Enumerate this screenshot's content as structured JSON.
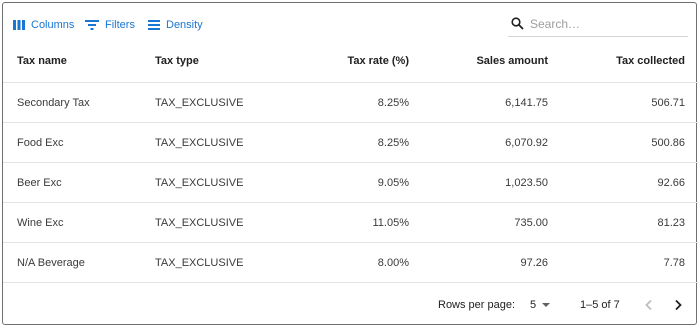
{
  "toolbar": {
    "columns_label": "Columns",
    "filters_label": "Filters",
    "density_label": "Density",
    "search_placeholder": "Search…",
    "accent_color": "#1976d2"
  },
  "table": {
    "columns": [
      "Tax name",
      "Tax type",
      "Tax rate (%)",
      "Sales amount",
      "Tax collected"
    ],
    "rows": [
      [
        "Secondary Tax",
        "TAX_EXCLUSIVE",
        "8.25%",
        "6,141.75",
        "506.71"
      ],
      [
        "Food Exc",
        "TAX_EXCLUSIVE",
        "8.25%",
        "6,070.92",
        "500.86"
      ],
      [
        "Beer Exc",
        "TAX_EXCLUSIVE",
        "9.05%",
        "1,023.50",
        "92.66"
      ],
      [
        "Wine Exc",
        "TAX_EXCLUSIVE",
        "11.05%",
        "735.00",
        "81.23"
      ],
      [
        "N/A Beverage",
        "TAX_EXCLUSIVE",
        "8.00%",
        "97.26",
        "7.78"
      ]
    ]
  },
  "pagination": {
    "rows_per_page_label": "Rows per page:",
    "rows_per_page_value": "5",
    "range_text": "1–5 of 7"
  }
}
